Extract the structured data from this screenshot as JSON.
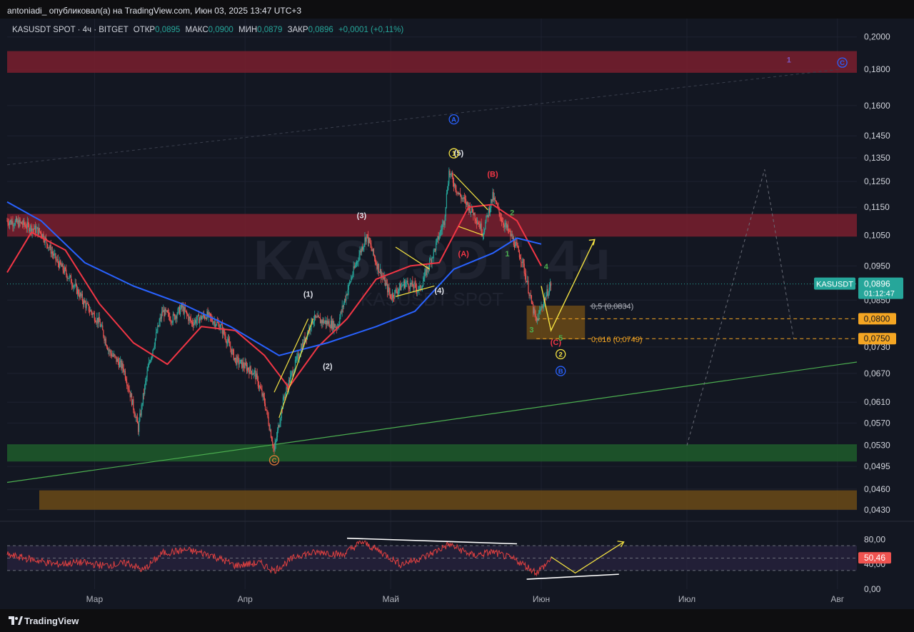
{
  "header": {
    "published": "antoniadi_ опубликовал(а) на TradingView.com, Июн 03, 2025 13:47 UTC+3"
  },
  "legend": {
    "symbol": "KASUSDT SPOT · 4ч · BITGET",
    "open_label": "ОТКР",
    "open": "0,0895",
    "high_label": "МАКС",
    "high": "0,0900",
    "low_label": "МИН",
    "low": "0,0879",
    "close_label": "ЗАКР",
    "close": "0,0896",
    "change": "+0,0001 (+0,11%)"
  },
  "watermark": {
    "main": "KASUSDT, 4ч",
    "sub": "KASUSDT SPOT"
  },
  "footer": {
    "brand": "TradingView"
  },
  "colors": {
    "background": "#131722",
    "candle_up": "#26a69a",
    "candle_down": "#ef5350",
    "ma_fast": "#f23645",
    "ma_slow": "#2962ff",
    "trendline": "#4caf50",
    "projection": "#f5e342",
    "resistance_zone": "#7a1f2e",
    "support_zone": "#1f5c2a",
    "demand_zone": "#6b4a16",
    "rsi_line": "#e04040",
    "rsi_band": "#2a2440"
  },
  "chart_data": {
    "type": "candlestick",
    "symbol": "KASUSDT",
    "exchange": "BITGET",
    "timeframe": "4ч",
    "x_axis": {
      "ticks": [
        "Мар",
        "Апр",
        "Май",
        "Июн",
        "Июл",
        "Авг"
      ],
      "start": "2025-02-11",
      "end": "2025-08-05"
    },
    "y_axis": {
      "scale": "log",
      "ticks": [
        "0,2000",
        "0,1800",
        "0,1600",
        "0,1450",
        "0,1350",
        "0,1250",
        "0,1150",
        "0,1050",
        "0,0950",
        "0,0850",
        "0,0730",
        "0,0670",
        "0,0610",
        "0,0570",
        "0,0530",
        "0,0495",
        "0,0460",
        "0,0430"
      ],
      "range": [
        0.0418,
        0.206
      ]
    },
    "price_path": [
      [
        "2025-02-11",
        0.11
      ],
      [
        "2025-02-14",
        0.109
      ],
      [
        "2025-02-18",
        0.106
      ],
      [
        "2025-02-21",
        0.097
      ],
      [
        "2025-02-24",
        0.091
      ],
      [
        "2025-02-27",
        0.084
      ],
      [
        "2025-03-02",
        0.079
      ],
      [
        "2025-03-04",
        0.072
      ],
      [
        "2025-03-07",
        0.068
      ],
      [
        "2025-03-10",
        0.056
      ],
      [
        "2025-03-12",
        0.068
      ],
      [
        "2025-03-15",
        0.082
      ],
      [
        "2025-03-17",
        0.08
      ],
      [
        "2025-03-19",
        0.083
      ],
      [
        "2025-03-21",
        0.079
      ],
      [
        "2025-03-24",
        0.081
      ],
      [
        "2025-03-27",
        0.078
      ],
      [
        "2025-03-30",
        0.07
      ],
      [
        "2025-04-03",
        0.067
      ],
      [
        "2025-04-05",
        0.061
      ],
      [
        "2025-04-07",
        0.052
      ],
      [
        "2025-04-09",
        0.062
      ],
      [
        "2025-04-12",
        0.071
      ],
      [
        "2025-04-15",
        0.08
      ],
      [
        "2025-04-18",
        0.079
      ],
      [
        "2025-04-20",
        0.078
      ],
      [
        "2025-04-23",
        0.092
      ],
      [
        "2025-04-26",
        0.105
      ],
      [
        "2025-04-28",
        0.096
      ],
      [
        "2025-05-01",
        0.086
      ],
      [
        "2025-05-04",
        0.09
      ],
      [
        "2025-05-07",
        0.088
      ],
      [
        "2025-05-10",
        0.1
      ],
      [
        "2025-05-12",
        0.11
      ],
      [
        "2025-05-13",
        0.129
      ],
      [
        "2025-05-15",
        0.12
      ],
      [
        "2025-05-18",
        0.113
      ],
      [
        "2025-05-20",
        0.106
      ],
      [
        "2025-05-22",
        0.119
      ],
      [
        "2025-05-24",
        0.11
      ],
      [
        "2025-05-26",
        0.104
      ],
      [
        "2025-05-28",
        0.097
      ],
      [
        "2025-05-30",
        0.084
      ],
      [
        "2025-05-31",
        0.079
      ],
      [
        "2025-06-01",
        0.083
      ],
      [
        "2025-06-03",
        0.0896
      ]
    ],
    "indicators": [
      {
        "name": "MA fast",
        "color": "#f23645",
        "path": [
          [
            "2025-02-11",
            0.093
          ],
          [
            "2025-02-16",
            0.106
          ],
          [
            "2025-02-23",
            0.1
          ],
          [
            "2025-03-02",
            0.084
          ],
          [
            "2025-03-09",
            0.074
          ],
          [
            "2025-03-16",
            0.069
          ],
          [
            "2025-03-23",
            0.078
          ],
          [
            "2025-03-30",
            0.077
          ],
          [
            "2025-04-05",
            0.071
          ],
          [
            "2025-04-10",
            0.064
          ],
          [
            "2025-04-16",
            0.073
          ],
          [
            "2025-04-22",
            0.08
          ],
          [
            "2025-04-28",
            0.091
          ],
          [
            "2025-05-05",
            0.095
          ],
          [
            "2025-05-11",
            0.096
          ],
          [
            "2025-05-17",
            0.115
          ],
          [
            "2025-05-22",
            0.116
          ],
          [
            "2025-05-27",
            0.11
          ],
          [
            "2025-06-01",
            0.095
          ]
        ]
      },
      {
        "name": "MA slow",
        "color": "#2962ff",
        "path": [
          [
            "2025-02-11",
            0.117
          ],
          [
            "2025-02-18",
            0.11
          ],
          [
            "2025-02-27",
            0.096
          ],
          [
            "2025-03-09",
            0.089
          ],
          [
            "2025-03-19",
            0.084
          ],
          [
            "2025-03-29",
            0.078
          ],
          [
            "2025-04-08",
            0.071
          ],
          [
            "2025-04-18",
            0.074
          ],
          [
            "2025-04-28",
            0.078
          ],
          [
            "2025-05-06",
            0.082
          ],
          [
            "2025-05-14",
            0.094
          ],
          [
            "2025-05-22",
            0.099
          ],
          [
            "2025-05-27",
            0.104
          ],
          [
            "2025-06-01",
            0.102
          ]
        ]
      }
    ],
    "last_price": {
      "label": "KASUSDT",
      "value": "0,0896",
      "countdown": "01:12:47"
    },
    "price_levels": [
      {
        "value": "0,0800",
        "style": "dashed",
        "color": "#f5a623"
      },
      {
        "value": "0,0750",
        "style": "dashed",
        "color": "#f5a623"
      }
    ],
    "fib_levels": [
      {
        "label": "0,5 (0,0834)",
        "value": 0.0834
      },
      {
        "label": "0,616 (0,0749)",
        "value": 0.0749
      }
    ],
    "zones": [
      {
        "name": "resistance-top",
        "from": 0.178,
        "to": 0.191,
        "color": "#7a1f2e"
      },
      {
        "name": "resistance-mid",
        "from": 0.1045,
        "to": 0.1125,
        "color": "#7a1f2e"
      },
      {
        "name": "support",
        "from": 0.0503,
        "to": 0.0532,
        "color": "#1f5c2a"
      },
      {
        "name": "demand-bottom",
        "from": 0.043,
        "to": 0.0458,
        "color": "#6b4a16"
      },
      {
        "name": "target-box",
        "from": 0.0748,
        "to": 0.0835,
        "start": "2025-05-29",
        "end": "2025-06-10",
        "color": "#6b4a16"
      }
    ],
    "wave_labels": [
      {
        "text": "(1)",
        "date": "2025-04-14",
        "price": 0.086
      },
      {
        "text": "(2)",
        "date": "2025-04-18",
        "price": 0.068
      },
      {
        "text": "(3)",
        "date": "2025-04-25",
        "price": 0.111
      },
      {
        "text": "(4)",
        "date": "2025-05-11",
        "price": 0.087
      },
      {
        "text": "(5)",
        "date": "2025-05-15",
        "price": 0.136
      },
      {
        "text": "(A)",
        "date": "2025-05-16",
        "price": 0.098
      },
      {
        "text": "(B)",
        "date": "2025-05-22",
        "price": 0.127
      },
      {
        "text": "(C)",
        "date": "2025-06-04",
        "price": 0.0735
      },
      {
        "text": "1",
        "date": "2025-05-25",
        "price": 0.098
      },
      {
        "text": "2",
        "date": "2025-05-26",
        "price": 0.112
      },
      {
        "text": "3",
        "date": "2025-05-30",
        "price": 0.0765
      },
      {
        "text": "4",
        "date": "2025-06-02",
        "price": 0.094
      },
      {
        "text": "5",
        "date": "2025-06-05",
        "price": 0.0745
      },
      {
        "text": "1",
        "date": "2025-07-22",
        "price": 0.184
      }
    ],
    "circle_labels": [
      {
        "text": "A",
        "date": "2025-05-14",
        "price": 0.153,
        "color": "#2962ff"
      },
      {
        "text": "1",
        "date": "2025-05-14",
        "price": 0.137,
        "color": "#f5e342"
      },
      {
        "text": "2",
        "date": "2025-06-05",
        "price": 0.0713,
        "color": "#f5e342"
      },
      {
        "text": "B",
        "date": "2025-06-05",
        "price": 0.0675,
        "color": "#2962ff"
      },
      {
        "text": "C",
        "date": "2025-04-07",
        "price": 0.0505,
        "color": "#e07b39"
      },
      {
        "text": "C",
        "date": "2025-08-02",
        "price": 0.184,
        "color": "#2962ff"
      }
    ],
    "projection_path": [
      [
        "2025-06-01",
        0.089
      ],
      [
        "2025-06-03",
        0.077
      ],
      [
        "2025-06-12",
        0.1035
      ]
    ],
    "dashed_projection_path": [
      [
        "2025-07-01",
        0.053
      ],
      [
        "2025-07-17",
        0.13
      ],
      [
        "2025-07-23",
        0.075
      ]
    ],
    "trendline_path": [
      [
        "2025-02-11",
        0.047
      ],
      [
        "2025-08-05",
        0.0695
      ]
    ],
    "rsi": {
      "ticks": [
        "80,00",
        "40,00",
        "0,00"
      ],
      "range": [
        0,
        100
      ],
      "band": [
        30,
        70
      ],
      "value": "50,46",
      "path": [
        [
          "2025-02-11",
          55
        ],
        [
          "2025-02-16",
          48
        ],
        [
          "2025-02-21",
          40
        ],
        [
          "2025-02-26",
          43
        ],
        [
          "2025-03-03",
          38
        ],
        [
          "2025-03-08",
          42
        ],
        [
          "2025-03-11",
          30
        ],
        [
          "2025-03-15",
          58
        ],
        [
          "2025-03-20",
          63
        ],
        [
          "2025-03-25",
          55
        ],
        [
          "2025-03-30",
          38
        ],
        [
          "2025-04-04",
          42
        ],
        [
          "2025-04-07",
          30
        ],
        [
          "2025-04-12",
          55
        ],
        [
          "2025-04-17",
          60
        ],
        [
          "2025-04-21",
          55
        ],
        [
          "2025-04-25",
          76
        ],
        [
          "2025-04-29",
          60
        ],
        [
          "2025-05-03",
          40
        ],
        [
          "2025-05-08",
          52
        ],
        [
          "2025-05-13",
          72
        ],
        [
          "2025-05-18",
          54
        ],
        [
          "2025-05-22",
          60
        ],
        [
          "2025-05-27",
          46
        ],
        [
          "2025-05-31",
          27
        ],
        [
          "2025-06-02",
          40
        ],
        [
          "2025-06-03",
          50
        ]
      ]
    }
  }
}
